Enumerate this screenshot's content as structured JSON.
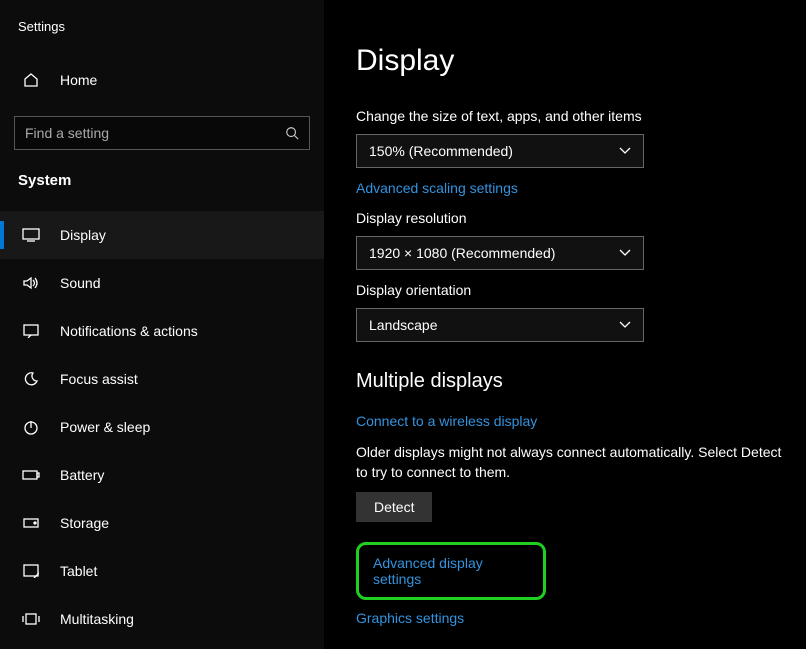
{
  "app_title": "Settings",
  "home_label": "Home",
  "search": {
    "placeholder": "Find a setting"
  },
  "category_label": "System",
  "nav": {
    "items": [
      {
        "label": "Display"
      },
      {
        "label": "Sound"
      },
      {
        "label": "Notifications & actions"
      },
      {
        "label": "Focus assist"
      },
      {
        "label": "Power & sleep"
      },
      {
        "label": "Battery"
      },
      {
        "label": "Storage"
      },
      {
        "label": "Tablet"
      },
      {
        "label": "Multitasking"
      }
    ]
  },
  "main": {
    "heading": "Display",
    "scale_label": "Change the size of text, apps, and other items",
    "scale_value": "150% (Recommended)",
    "advanced_scaling_link": "Advanced scaling settings",
    "resolution_label": "Display resolution",
    "resolution_value": "1920 × 1080 (Recommended)",
    "orientation_label": "Display orientation",
    "orientation_value": "Landscape",
    "multiple_displays_heading": "Multiple displays",
    "wireless_link": "Connect to a wireless display",
    "detect_text": "Older displays might not always connect automatically. Select Detect to try to connect to them.",
    "detect_button": "Detect",
    "advanced_display_link": "Advanced display settings",
    "graphics_link": "Graphics settings"
  }
}
